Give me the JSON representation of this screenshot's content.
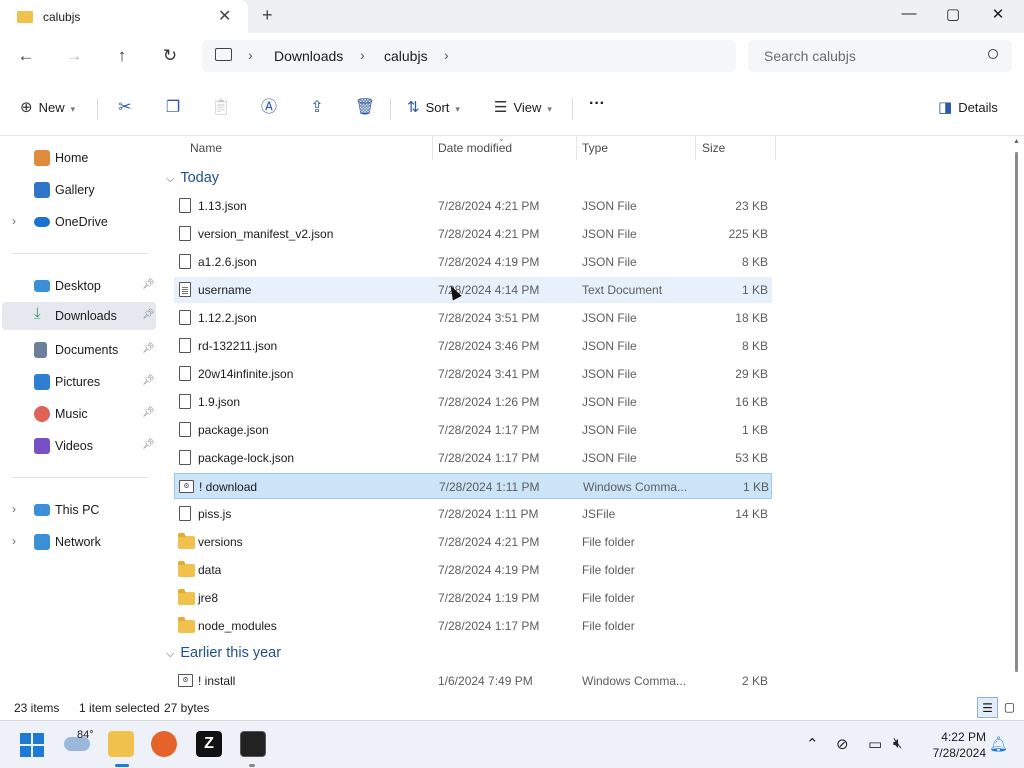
{
  "window": {
    "tab_title": "calubjs",
    "new_tab_symbol": "+",
    "close_tab_symbol": "✕"
  },
  "address": {
    "crumbs": [
      "Downloads",
      "calubjs"
    ],
    "search_placeholder": "Search calubjs"
  },
  "commands": {
    "new_label": "New",
    "sort_label": "Sort",
    "view_label": "View",
    "more_label": "···",
    "details_label": "Details"
  },
  "sidebar": {
    "items": [
      {
        "label": "Home",
        "icon": "home-icon",
        "color": "#e08a3c"
      },
      {
        "label": "Gallery",
        "icon": "gallery-icon",
        "color": "#2f76c9"
      },
      {
        "label": "OneDrive",
        "icon": "onedrive-icon",
        "color": "#1a73d1"
      },
      {
        "label": "Desktop",
        "icon": "desktop-icon",
        "color": "#3a8fd6"
      },
      {
        "label": "Downloads",
        "icon": "downloads-icon",
        "color": "#2a9d5a"
      },
      {
        "label": "Documents",
        "icon": "documents-icon",
        "color": "#6a7f99"
      },
      {
        "label": "Pictures",
        "icon": "pictures-icon",
        "color": "#2e7fd1"
      },
      {
        "label": "Music",
        "icon": "music-icon",
        "color": "#e0635a"
      },
      {
        "label": "Videos",
        "icon": "videos-icon",
        "color": "#7a4fc4"
      },
      {
        "label": "This PC",
        "icon": "this-pc-icon",
        "color": "#3a8fd6"
      },
      {
        "label": "Network",
        "icon": "network-icon",
        "color": "#3a8fd6"
      }
    ]
  },
  "columns": {
    "name": "Name",
    "date": "Date modified",
    "type": "Type",
    "size": "Size"
  },
  "groups": {
    "today": "Today",
    "earlier": "Earlier this year"
  },
  "files_today": [
    {
      "name": "1.13.json",
      "date": "7/28/2024 4:21 PM",
      "type": "JSON File",
      "size": "23 KB"
    },
    {
      "name": "version_manifest_v2.json",
      "date": "7/28/2024 4:21 PM",
      "type": "JSON File",
      "size": "225 KB"
    },
    {
      "name": "a1.2.6.json",
      "date": "7/28/2024 4:19 PM",
      "type": "JSON File",
      "size": "8 KB"
    },
    {
      "name": "username",
      "date": "7/28/2024 4:14 PM",
      "type": "Text Document",
      "size": "1 KB"
    },
    {
      "name": "1.12.2.json",
      "date": "7/28/2024 3:51 PM",
      "type": "JSON File",
      "size": "18 KB"
    },
    {
      "name": "rd-132211.json",
      "date": "7/28/2024 3:46 PM",
      "type": "JSON File",
      "size": "8 KB"
    },
    {
      "name": "20w14infinite.json",
      "date": "7/28/2024 3:41 PM",
      "type": "JSON File",
      "size": "29 KB"
    },
    {
      "name": "1.9.json",
      "date": "7/28/2024 1:26 PM",
      "type": "JSON File",
      "size": "16 KB"
    },
    {
      "name": "package.json",
      "date": "7/28/2024 1:17 PM",
      "type": "JSON File",
      "size": "1 KB"
    },
    {
      "name": "package-lock.json",
      "date": "7/28/2024 1:17 PM",
      "type": "JSON File",
      "size": "53 KB"
    },
    {
      "name": "! download",
      "date": "7/28/2024 1:11 PM",
      "type": "Windows Comma...",
      "size": "1 KB"
    },
    {
      "name": "piss.js",
      "date": "7/28/2024 1:11 PM",
      "type": "JSFile",
      "size": "14 KB"
    },
    {
      "name": "versions",
      "date": "7/28/2024 4:21 PM",
      "type": "File folder",
      "size": ""
    },
    {
      "name": "data",
      "date": "7/28/2024 4:19 PM",
      "type": "File folder",
      "size": ""
    },
    {
      "name": "jre8",
      "date": "7/28/2024 1:19 PM",
      "type": "File folder",
      "size": ""
    },
    {
      "name": "node_modules",
      "date": "7/28/2024 1:17 PM",
      "type": "File folder",
      "size": ""
    }
  ],
  "files_earlier": [
    {
      "name": "! install",
      "date": "1/6/2024 7:49 PM",
      "type": "Windows Comma...",
      "size": "2 KB"
    }
  ],
  "status": {
    "count": "23 items",
    "selected": "1 item selected",
    "selected_size": "27 bytes"
  },
  "taskbar": {
    "weather_temp": "84°",
    "time": "4:22 PM",
    "date": "7/28/2024"
  },
  "colors": {
    "accent": "#1f4f91",
    "selection": "#cce4f7",
    "folder": "#f0c24d"
  }
}
